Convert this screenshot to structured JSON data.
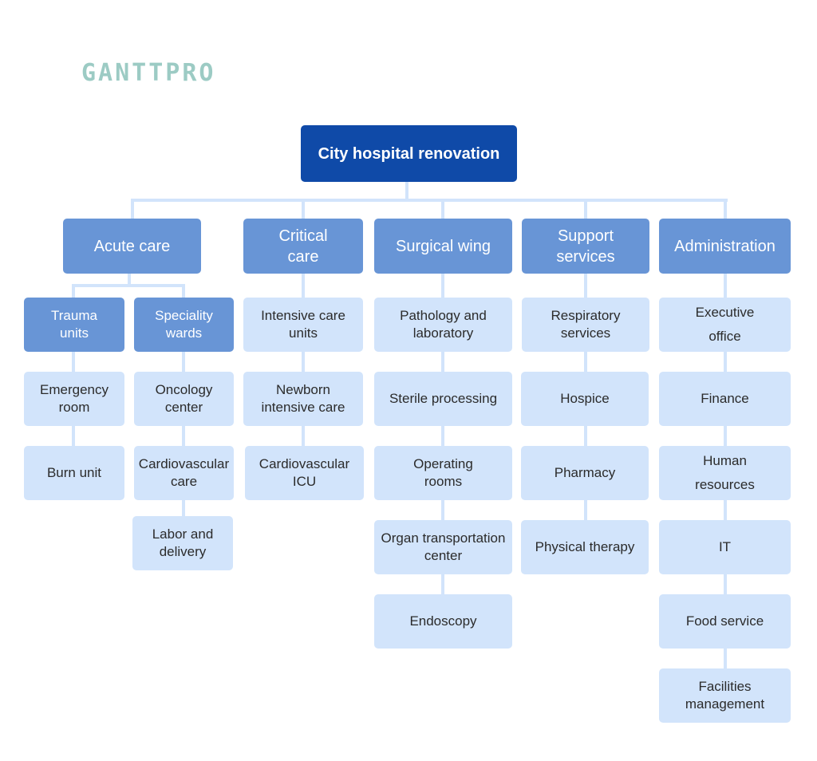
{
  "logo": "GANTTPRO",
  "colors": {
    "root": "#0f4aa8",
    "category": "#6895d6",
    "leaf": "#d2e4fb",
    "connector": "#d2e4fb",
    "logo": "#9ccbc4"
  },
  "root": "City hospital renovation",
  "categories": [
    {
      "label": "Acute care",
      "subgroups": [
        {
          "label": "Trauma units",
          "items": [
            "Emergency room",
            "Burn unit"
          ]
        },
        {
          "label": "Speciality wards",
          "items": [
            "Oncology center",
            "Cardiovascular care",
            "Labor and delivery"
          ]
        }
      ]
    },
    {
      "label": "Critical care",
      "items": [
        "Intensive care units",
        "Newborn intensive care",
        "Cardiovascular ICU"
      ]
    },
    {
      "label": "Surgical wing",
      "items": [
        "Pathology and laboratory",
        "Sterile processing",
        "Operating rooms",
        "Organ transportation center",
        "Endoscopy"
      ]
    },
    {
      "label": "Support services",
      "items": [
        "Respiratory services",
        "Hospice",
        "Pharmacy",
        "Physical therapy"
      ]
    },
    {
      "label": "Administration",
      "items": [
        "Executive office",
        "Finance",
        "Human resources",
        "IT",
        "Food service",
        "Facilities management"
      ]
    }
  ]
}
